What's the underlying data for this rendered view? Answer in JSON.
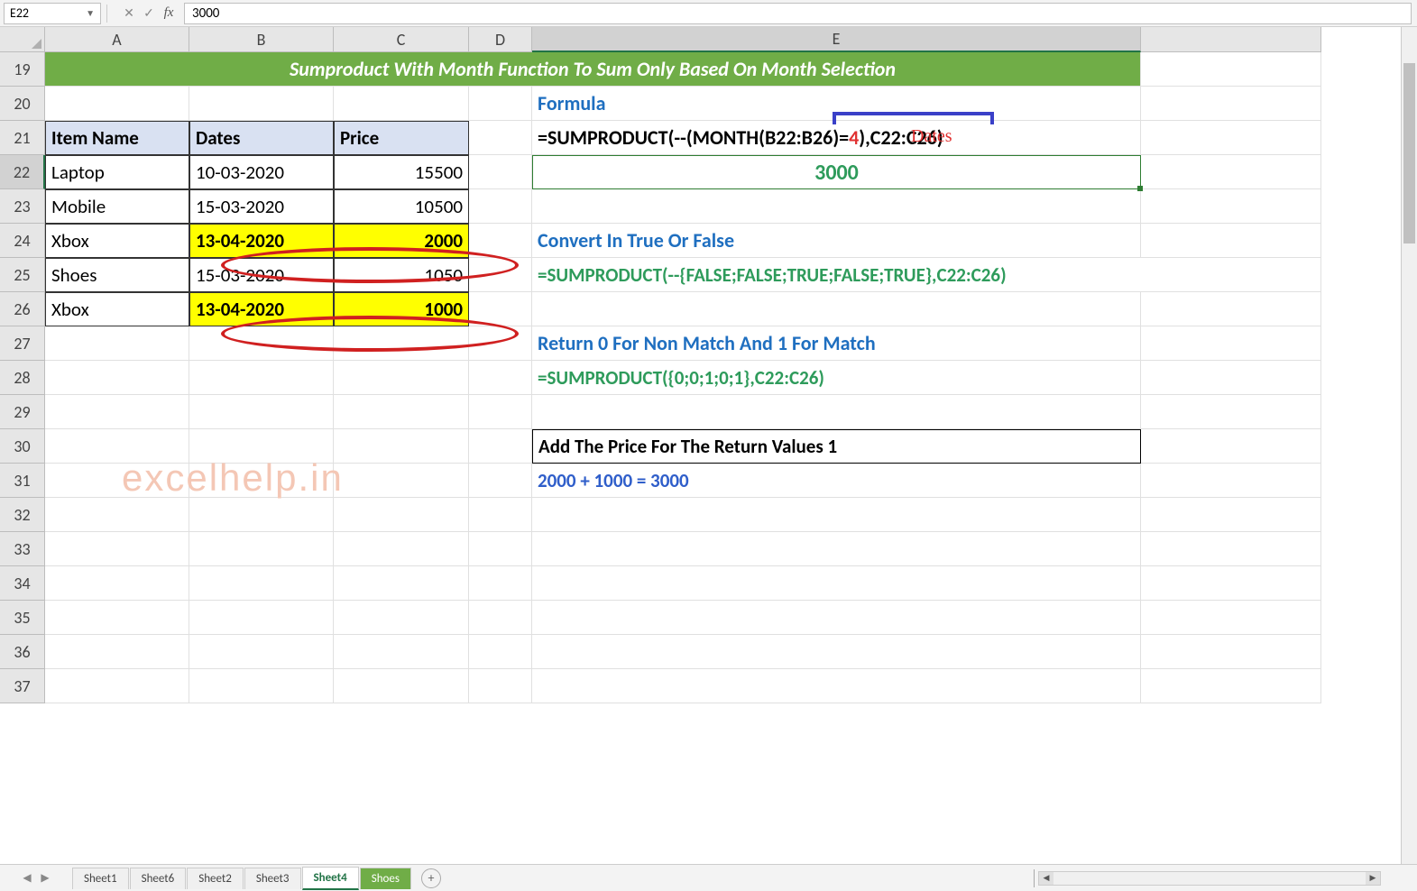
{
  "formula_bar": {
    "name_box": "E22",
    "cancel_icon": "✕",
    "enter_icon": "✓",
    "fx_label": "fx",
    "value": "3000"
  },
  "columns": [
    "A",
    "B",
    "C",
    "D",
    "E"
  ],
  "rows": [
    "19",
    "20",
    "21",
    "22",
    "23",
    "24",
    "25",
    "26",
    "27",
    "28",
    "29",
    "30",
    "31",
    "32",
    "33",
    "34",
    "35",
    "36",
    "37"
  ],
  "selected_cell": {
    "row": "22",
    "col": "E"
  },
  "title": "Sumproduct With Month Function To Sum Only Based On Month Selection",
  "table": {
    "headers": [
      "Item Name",
      "Dates",
      "Price"
    ],
    "rows": [
      {
        "item": "Laptop",
        "date": "10-03-2020",
        "price": "15500",
        "highlight": false
      },
      {
        "item": "Mobile",
        "date": "15-03-2020",
        "price": "10500",
        "highlight": false
      },
      {
        "item": "Xbox",
        "date": "13-04-2020",
        "price": "2000",
        "highlight": true
      },
      {
        "item": "Shoes",
        "date": "15-03-2020",
        "price": "1050",
        "highlight": false
      },
      {
        "item": "Xbox",
        "date": "13-04-2020",
        "price": "1000",
        "highlight": true
      }
    ]
  },
  "annotations": {
    "dates_label": "Dates",
    "red_number": "4"
  },
  "explain": {
    "formula_label": "Formula",
    "formula_pre": "=SUMPRODUCT(--(MONTH(B22:B26)=",
    "formula_post": "),C22:C26)",
    "result": "3000",
    "step1_label": "Convert In True Or False",
    "step1_text": "=SUMPRODUCT(--{FALSE;FALSE;TRUE;FALSE;TRUE},C22:C26)",
    "step2_label": "Return 0 For Non Match And 1 For Match",
    "step2_text": "=SUMPRODUCT({0;0;1;0;1},C22:C26)",
    "step3_label": "Add The Price For The Return Values 1",
    "step3_text": "2000 + 1000 = 3000"
  },
  "watermark": "excelhelp.in",
  "tabs": {
    "items": [
      "Sheet1",
      "Sheet6",
      "Sheet2",
      "Sheet3",
      "Sheet4",
      "Shoes"
    ],
    "active": "Sheet4",
    "add_label": "+"
  }
}
